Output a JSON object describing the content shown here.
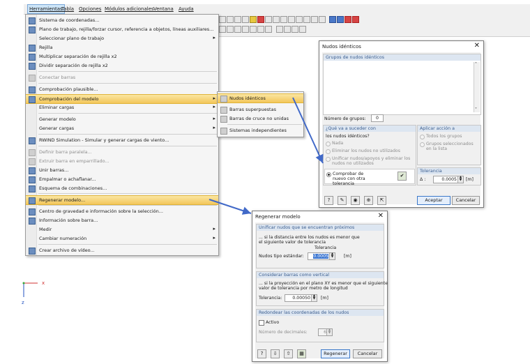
{
  "menubar": {
    "items": [
      "Herramientas",
      "Tabla",
      "Opciones",
      "Módulos adicionales",
      "Ventana",
      "Ayuda"
    ]
  },
  "menu": {
    "items": [
      {
        "label": "Sistema de coordenadas...",
        "enabled": true,
        "submenu": false
      },
      {
        "label": "Plano de trabajo, rejilla/forzar cursor, referencia a objetos, líneas auxiliares...",
        "enabled": true,
        "submenu": false
      },
      {
        "label": "Seleccionar plano de trabajo",
        "enabled": true,
        "submenu": true
      },
      {
        "label": "Rejilla",
        "enabled": true,
        "submenu": false
      },
      {
        "label": "Multiplicar separación de rejilla x2",
        "enabled": true,
        "submenu": false
      },
      {
        "label": "Dividir separación de rejilla x2",
        "enabled": true,
        "submenu": false
      },
      {
        "label": "Conectar barras",
        "enabled": false,
        "submenu": false
      },
      {
        "label": "Comprobación plausible...",
        "enabled": true,
        "submenu": false
      },
      {
        "label": "Comprobación del modelo",
        "enabled": true,
        "submenu": true
      },
      {
        "label": "Eliminar cargas",
        "enabled": true,
        "submenu": true
      },
      {
        "label": "Generar modelo",
        "enabled": true,
        "submenu": true
      },
      {
        "label": "Generar cargas",
        "enabled": true,
        "submenu": true
      },
      {
        "label": "RWIND Simulation - Simular y generar cargas de viento...",
        "enabled": true,
        "submenu": false
      },
      {
        "label": "Definir barra paralela...",
        "enabled": false,
        "submenu": false
      },
      {
        "label": "Extruir barra en emparrillado...",
        "enabled": false,
        "submenu": false
      },
      {
        "label": "Unir barras...",
        "enabled": true,
        "submenu": false
      },
      {
        "label": "Empalmar o achaflanar...",
        "enabled": true,
        "submenu": false
      },
      {
        "label": "Esquema de combinaciones...",
        "enabled": true,
        "submenu": false
      },
      {
        "label": "Regenerar modelo...",
        "enabled": true,
        "submenu": false
      },
      {
        "label": "Centro de gravedad e información sobre la selección...",
        "enabled": true,
        "submenu": false
      },
      {
        "label": "Información sobre barra...",
        "enabled": true,
        "submenu": false
      },
      {
        "label": "Medir",
        "enabled": true,
        "submenu": true
      },
      {
        "label": "Cambiar numeración",
        "enabled": true,
        "submenu": true
      },
      {
        "label": "Crear archivo de vídeo...",
        "enabled": true,
        "submenu": false
      }
    ]
  },
  "submenu": {
    "items": [
      "Nudos idénticos",
      "Barras superpuestas",
      "Barras de cruce no unidas",
      "Sistemas independientes"
    ]
  },
  "nudos_dialog": {
    "title": "Nudos idénticos",
    "group_header": "Grupos de nudos idénticos",
    "num_groups_label": "Número de grupos:",
    "num_groups_value": "0",
    "what_header": "¿Qué va a suceder con",
    "what_sub": "los nudos idénticos?",
    "options": [
      "Nada",
      "Eliminar los nudos no utilizados",
      "Unificar nudos/apoyos y eliminar los nudos no utilizados"
    ],
    "recheck_label": "Comprobar de nuevo con otra tolerancia",
    "apply_header": "Aplicar acción a",
    "apply_options": [
      "Todos los grupos",
      "Grupos seleccionados en la lista"
    ],
    "tol_header": "Tolerancia",
    "tol_symbol": "Δ :",
    "tol_value": "0.0005",
    "tol_unit": "[m]",
    "ok": "Aceptar",
    "cancel": "Cancelar"
  },
  "regen_dialog": {
    "title": "Regenerar modelo",
    "g1_header": "Unificar nudos que se encuentran próximos",
    "g1_text1": "... si la distancia entre los nudos es menor que",
    "g1_text2": "el siguiente valor de tolerancia",
    "g1_tol_label": "Tolerancia",
    "g1_field_label": "Nudos tipo estándar:",
    "g1_value": "0.0005",
    "g1_unit": "[m]",
    "g2_header": "Considerar barras como vertical",
    "g2_text1": "... si la proyección en el plano XY es menor que el siguiente",
    "g2_text2": "valor de tolerancia por metro de longitud",
    "g2_field_label": "Tolerancia:",
    "g2_value": "0.00050",
    "g2_unit": "[m]",
    "g3_header": "Redondear las coordenadas de los nudos",
    "g3_check": "Activo",
    "g3_decimals_label": "Número de decimales:",
    "g3_decimals_value": "6",
    "ok": "Regenerar",
    "cancel": "Cancelar"
  },
  "axes": {
    "x": "x",
    "z": "z"
  },
  "colors": {
    "arrow": "#4169c8",
    "highlight": "#f3c65a",
    "axis_x": "#d03030",
    "axis_z": "#2050c0"
  }
}
